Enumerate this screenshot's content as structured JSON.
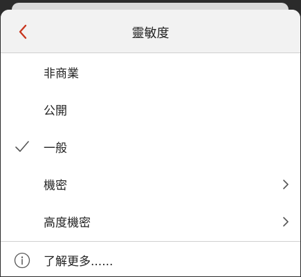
{
  "header": {
    "title": "靈敏度",
    "back_icon": "chevron-left-icon",
    "accent_color": "#c8361e"
  },
  "options": [
    {
      "label": "非商業",
      "selected": false,
      "has_submenu": false
    },
    {
      "label": "公開",
      "selected": false,
      "has_submenu": false
    },
    {
      "label": "一般",
      "selected": true,
      "has_submenu": false
    },
    {
      "label": "機密",
      "selected": false,
      "has_submenu": true
    },
    {
      "label": "高度機密",
      "selected": false,
      "has_submenu": true
    }
  ],
  "footer": {
    "learn_more_label": "了解更多......",
    "icon": "info-icon"
  }
}
